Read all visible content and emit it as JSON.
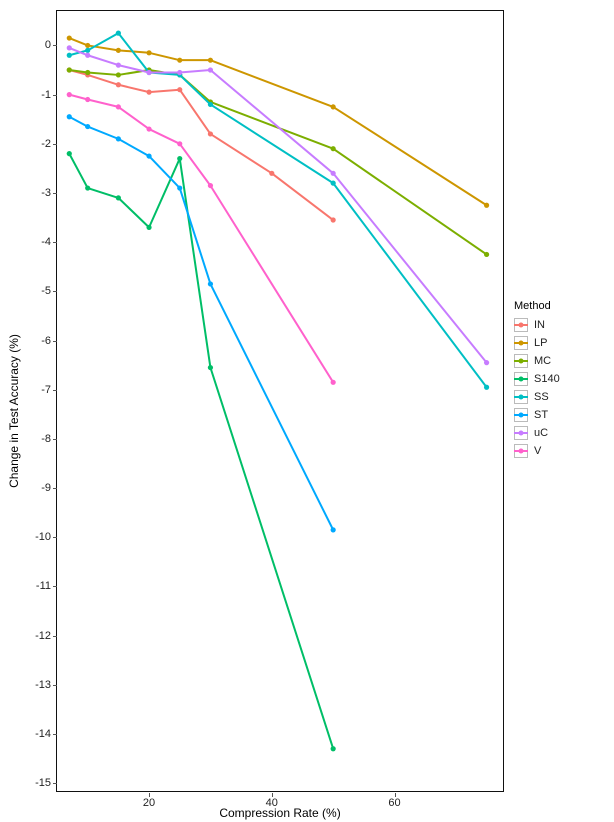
{
  "chart_data": {
    "type": "line",
    "title": "",
    "xlabel": "Compression Rate (%)",
    "ylabel": "Change in Test Accuracy (%)",
    "xlim": [
      5,
      78
    ],
    "ylim": [
      -15.2,
      0.7
    ],
    "x_ticks": [
      20,
      40,
      60
    ],
    "y_ticks": [
      0,
      -1,
      -2,
      -3,
      -4,
      -5,
      -6,
      -7,
      -8,
      -9,
      -10,
      -11,
      -12,
      -13,
      -14,
      -15
    ],
    "legend_title": "Method",
    "legend_position": "right",
    "series": [
      {
        "name": "IN",
        "color": "#F8766D",
        "x": [
          7,
          10,
          15,
          20,
          25,
          30,
          40,
          50
        ],
        "values": [
          -0.5,
          -0.6,
          -0.8,
          -0.95,
          -0.9,
          -1.8,
          -2.6,
          -3.55
        ]
      },
      {
        "name": "LP",
        "color": "#CD9600",
        "x": [
          7,
          10,
          15,
          20,
          25,
          30,
          50,
          75
        ],
        "values": [
          0.15,
          0.0,
          -0.1,
          -0.15,
          -0.3,
          -0.3,
          -1.25,
          -3.25
        ]
      },
      {
        "name": "MC",
        "color": "#7CAE00",
        "x": [
          7,
          10,
          15,
          20,
          25,
          30,
          50,
          75
        ],
        "values": [
          -0.5,
          -0.55,
          -0.6,
          -0.5,
          -0.6,
          -1.15,
          -2.1,
          -4.25
        ]
      },
      {
        "name": "S140",
        "color": "#00BE67",
        "x": [
          7,
          10,
          15,
          20,
          25,
          30,
          50
        ],
        "values": [
          -2.2,
          -2.9,
          -3.1,
          -3.7,
          -2.3,
          -6.55,
          -14.3
        ]
      },
      {
        "name": "SS",
        "color": "#00BFC4",
        "x": [
          7,
          10,
          15,
          20,
          25,
          30,
          50,
          75
        ],
        "values": [
          -0.2,
          -0.1,
          0.25,
          -0.55,
          -0.6,
          -1.2,
          -2.8,
          -6.95
        ]
      },
      {
        "name": "ST",
        "color": "#00A9FF",
        "x": [
          7,
          10,
          15,
          20,
          25,
          30,
          50
        ],
        "values": [
          -1.45,
          -1.65,
          -1.9,
          -2.25,
          -2.9,
          -4.85,
          -9.85
        ]
      },
      {
        "name": "uC",
        "color": "#C77CFF",
        "x": [
          7,
          10,
          15,
          20,
          25,
          30,
          50,
          75
        ],
        "values": [
          -0.05,
          -0.2,
          -0.4,
          -0.55,
          -0.55,
          -0.5,
          -2.6,
          -6.45
        ]
      },
      {
        "name": "V",
        "color": "#FF61CC",
        "x": [
          7,
          10,
          15,
          20,
          25,
          30,
          50
        ],
        "values": [
          -1.0,
          -1.1,
          -1.25,
          -1.7,
          -2.0,
          -2.85,
          -6.85
        ]
      }
    ]
  }
}
